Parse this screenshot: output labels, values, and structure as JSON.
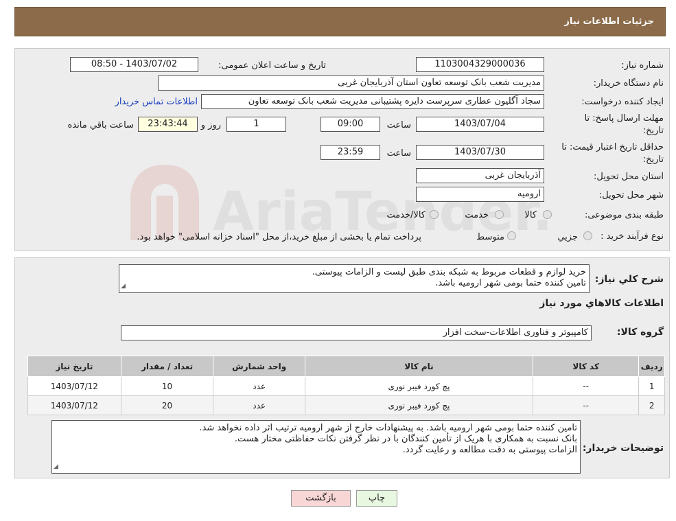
{
  "header": {
    "title": "جزئیات اطلاعات نیاز"
  },
  "form": {
    "need_number": {
      "label": "شماره نیاز:",
      "value": "1103004329000036"
    },
    "announce": {
      "label": "تاریخ و ساعت اعلان عمومی:",
      "value": "1403/07/02 - 08:50"
    },
    "buyer_org": {
      "label": "نام دستگاه خریدار:",
      "value": "مدیریت شعب بانک توسعه تعاون استان آذربایجان غربی"
    },
    "creator": {
      "label": "ایجاد کننده درخواست:",
      "value": "سجاد آگلیون عطاری سرپرست دایره پشتیبانی مدیریت شعب بانک توسعه تعاون",
      "contact_link": "اطلاعات تماس خریدار"
    },
    "deadline": {
      "label_line1": "مهلت ارسال پاسخ: تا",
      "label_line2": "تاریخ:",
      "date": "1403/07/04",
      "time_label": "ساعت",
      "time": "09:00",
      "days": "1",
      "days_label": "روز و",
      "remaining": "23:43:44",
      "remaining_label": "ساعت باقي مانده"
    },
    "validity": {
      "label_line1": "حداقل تاریخ اعتبار قیمت: تا",
      "label_line2": "تاریخ:",
      "date": "1403/07/30",
      "time_label": "ساعت",
      "time": "23:59"
    },
    "province": {
      "label": "استان محل تحویل:",
      "value": "آذربایجان غربی"
    },
    "city": {
      "label": "شهر محل تحویل:",
      "value": "ارومیه"
    },
    "category": {
      "label": "طبقه بندی موضوعی:",
      "options": [
        "کالا",
        "خدمت",
        "کالا/خدمت"
      ]
    },
    "process": {
      "label": "نوع فرآیند خرید :",
      "options": [
        "جزیي",
        "متوسط"
      ],
      "note": "پرداخت تمام یا بخشی از مبلغ خرید،از محل \"اسناد خزانه اسلامی\" خواهد بود."
    }
  },
  "summary": {
    "label": "شرح کلي نياز:",
    "lines": [
      "خرید لوازم و قطعات مربوط به شبکه بندی طبق لیست و الزامات پیوستی.",
      "تامین کننده حتما بومی شهر ارومیه باشد."
    ]
  },
  "goods": {
    "section_title": "اطلاعات کالاهاي مورد نياز",
    "group_label": "گروه کالا:",
    "group_value": "کامپیوتر و فناوری اطلاعات-سخت افزار",
    "columns": [
      "رديف",
      "کد کالا",
      "نام کالا",
      "واحد شمارش",
      "تعداد / مقدار",
      "تاريخ نياز"
    ],
    "rows": [
      [
        "1",
        "--",
        "پچ کورد فیبر نوری",
        "عدد",
        "10",
        "1403/07/12"
      ],
      [
        "2",
        "--",
        "پچ کورد فیبر نوری",
        "عدد",
        "20",
        "1403/07/12"
      ]
    ]
  },
  "buyer_notes": {
    "label": "توضيحات خريدار:",
    "lines": [
      "تامین کننده حتما بومی شهر ارومیه باشد. به پیشنهادات خارج از شهر ارومیه ترتیب اثر داده نخواهد شد.",
      "بانک نسبت به همکاری با هریک از تأمین کنندگان با در نظر گرفتن نکات حفاظتی  مختار هست.",
      "الزامات پیوستی به دقت مطالعه و رعایت گردد."
    ]
  },
  "buttons": {
    "print": "چاپ",
    "back": "بازگشت"
  },
  "watermark_text": "AriaTender.neT",
  "colors": {
    "header_bg": "#8b6b49",
    "print_bg": "#e8f7e0",
    "back_bg": "#f9d6d6"
  }
}
